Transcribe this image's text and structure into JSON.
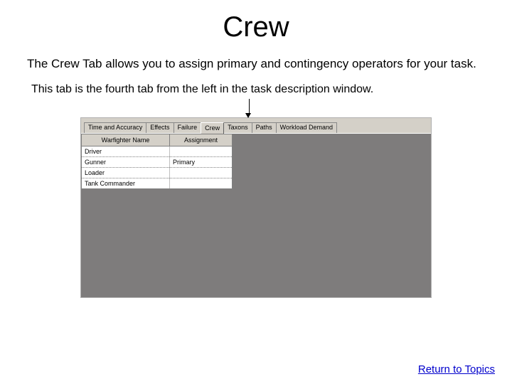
{
  "title": "Crew",
  "intro": "The Crew Tab allows you to assign primary and contingency operators for your task.",
  "sub": "This tab is the fourth tab from the left in the task description window.",
  "tabs": [
    {
      "label": "Time and Accuracy"
    },
    {
      "label": "Effects"
    },
    {
      "label": "Failure"
    },
    {
      "label": "Crew"
    },
    {
      "label": "Taxons"
    },
    {
      "label": "Paths"
    },
    {
      "label": "Workload Demand"
    }
  ],
  "grid": {
    "headers": {
      "name": "Warfighter Name",
      "assignment": "Assignment"
    },
    "rows": [
      {
        "name": "Driver",
        "assignment": ""
      },
      {
        "name": "Gunner",
        "assignment": "Primary"
      },
      {
        "name": "Loader",
        "assignment": ""
      },
      {
        "name": "Tank Commander",
        "assignment": ""
      }
    ]
  },
  "return_link": "Return to Topics"
}
